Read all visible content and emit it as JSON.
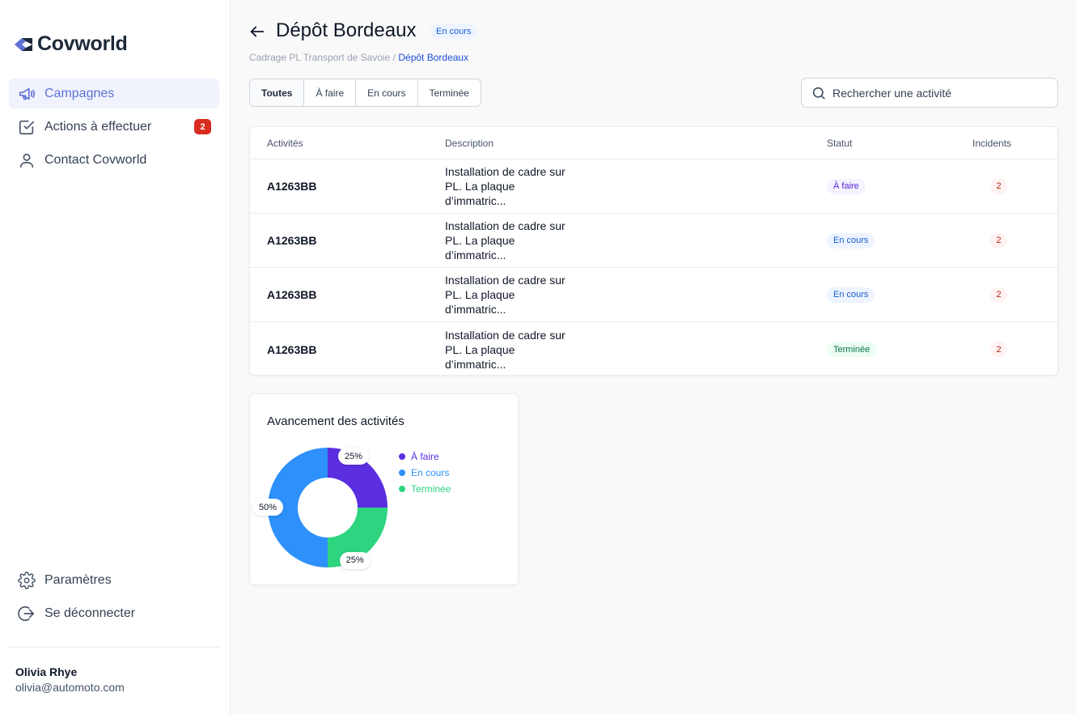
{
  "app": {
    "name": "Covworld"
  },
  "sidebar": {
    "items": [
      {
        "label": "Campagnes",
        "icon": "megaphone-icon",
        "active": true
      },
      {
        "label": "Actions à effectuer",
        "icon": "check-square-icon",
        "badge": "2"
      },
      {
        "label": "Contact Covworld",
        "icon": "user-icon"
      }
    ],
    "bottom_items": [
      {
        "label": "Paramètres",
        "icon": "gear-icon"
      },
      {
        "label": "Se déconnecter",
        "icon": "logout-icon"
      }
    ],
    "user": {
      "name": "Olivia Rhye",
      "email": "olivia@automoto.com"
    }
  },
  "header": {
    "title": "Dépôt Bordeaux",
    "status": "En cours",
    "breadcrumb": {
      "parent": "Cadrage PL Transport de Savoie",
      "separator": "/",
      "current": "Dépôt Bordeaux"
    }
  },
  "tabs": [
    "Toutes",
    "À faire",
    "En cours",
    "Terminée"
  ],
  "search": {
    "placeholder": "Rechercher une activité"
  },
  "table": {
    "headers": [
      "Activités",
      "Description",
      "Statut",
      "Incidents"
    ],
    "rows": [
      {
        "id": "A1263BB",
        "description": [
          "Installation de cadre sur",
          "PL. La plaque",
          "d’immatric..."
        ],
        "status": "À faire",
        "incidents": "2"
      },
      {
        "id": "A1263BB",
        "description": [
          "Installation de cadre sur",
          "PL. La plaque",
          "d’immatric..."
        ],
        "status": "En cours",
        "incidents": "2"
      },
      {
        "id": "A1263BB",
        "description": [
          "Installation de cadre sur",
          "PL. La plaque",
          "d’immatric..."
        ],
        "status": "En cours",
        "incidents": "2"
      },
      {
        "id": "A1263BB",
        "description": [
          "Installation de cadre sur",
          "PL. La plaque",
          "d’immatric..."
        ],
        "status": "Terminée",
        "incidents": "2"
      }
    ]
  },
  "status_colors": {
    "À faire": {
      "bg": "#f4f3ff",
      "fg": "#5925dc"
    },
    "En cours": {
      "bg": "#eef4ff",
      "fg": "#175cd3"
    },
    "Terminée": {
      "bg": "#ecfdf3",
      "fg": "#067647"
    }
  },
  "chart_data": {
    "type": "pie",
    "title": "Avancement des activités",
    "categories": [
      "À faire",
      "En cours",
      "Terminée"
    ],
    "values": [
      25,
      50,
      25
    ],
    "value_labels": [
      "25%",
      "50%",
      "25%"
    ],
    "colors": [
      "#5b2ee0",
      "#2e90fa",
      "#2ed480"
    ],
    "donut": true,
    "legend": "right"
  },
  "colors": {
    "accent": "#6172d6",
    "danger": "#d92d20"
  }
}
